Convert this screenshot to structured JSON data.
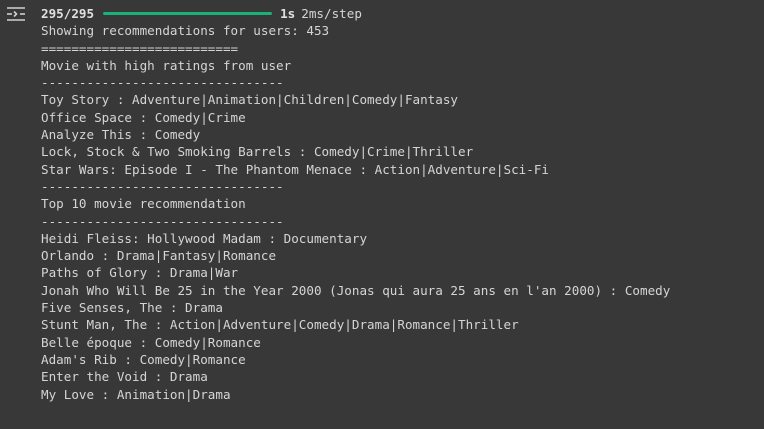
{
  "progress": {
    "count": "295/295",
    "fraction": 1.0,
    "time": "1s",
    "step": "2ms/step",
    "bar_color": "#19b37a"
  },
  "output": {
    "header_line": "Showing recommendations for users: 453",
    "separator_double": "==========================",
    "high_ratings_title": "Movie with high ratings from user",
    "separator_dash": "--------------------------------",
    "high_rated": [
      "Toy Story : Adventure|Animation|Children|Comedy|Fantasy",
      "Office Space : Comedy|Crime",
      "Analyze This : Comedy",
      "Lock, Stock & Two Smoking Barrels : Comedy|Crime|Thriller",
      "Star Wars: Episode I - The Phantom Menace : Action|Adventure|Sci-Fi"
    ],
    "separator_dash_2": "--------------------------------",
    "top10_title": "Top 10 movie recommendation",
    "separator_dash_3": "--------------------------------",
    "recommendations": [
      "Heidi Fleiss: Hollywood Madam : Documentary",
      "Orlando : Drama|Fantasy|Romance",
      "Paths of Glory : Drama|War",
      "Jonah Who Will Be 25 in the Year 2000 (Jonas qui aura 25 ans en l'an 2000) : Comedy",
      "Five Senses, The : Drama",
      "Stunt Man, The : Action|Adventure|Comedy|Drama|Romance|Thriller",
      "Belle époque : Comedy|Romance",
      "Adam's Rib : Comedy|Romance",
      "Enter the Void : Drama",
      "My Love : Animation|Drama"
    ]
  },
  "icons": {
    "toggle": "output-toggle-icon"
  }
}
